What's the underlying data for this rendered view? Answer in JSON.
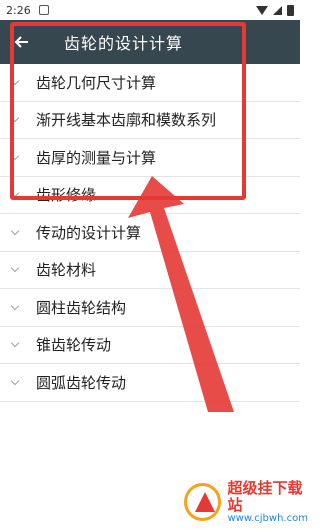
{
  "status_bar": {
    "time": "2:26",
    "icons": [
      "notification-icon",
      "wifi-icon",
      "signal-icon",
      "battery-icon"
    ]
  },
  "app_bar": {
    "title": "齿轮的设计计算",
    "back_icon": "arrow-back-icon"
  },
  "list": {
    "items": [
      {
        "label": "齿轮几何尺寸计算"
      },
      {
        "label": "渐开线基本齿廓和模数系列"
      },
      {
        "label": "齿厚的测量与计算"
      },
      {
        "label": "齿形修缘"
      },
      {
        "label": "传动的设计计算"
      },
      {
        "label": "齿轮材料"
      },
      {
        "label": "圆柱齿轮结构"
      },
      {
        "label": "锥齿轮传动"
      },
      {
        "label": "圆弧齿轮传动"
      }
    ]
  },
  "colors": {
    "app_bar_bg": "#37474f",
    "highlight": "#e53935",
    "divider": "#e4e4e4"
  },
  "watermark": {
    "title": "超级挂下载站",
    "url": "www.cjbwh.com"
  }
}
